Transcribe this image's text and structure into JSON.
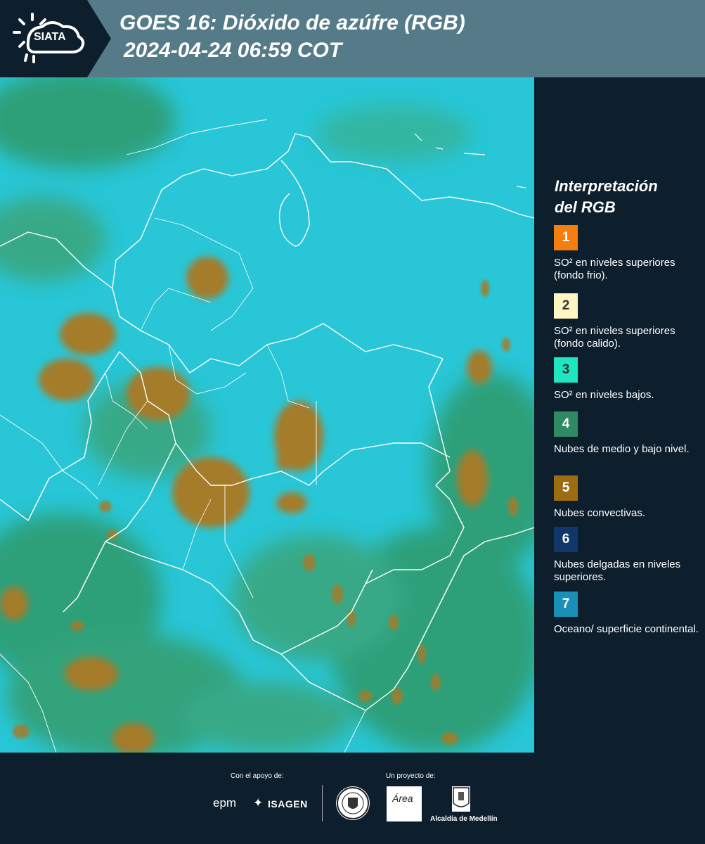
{
  "header": {
    "title_line1": "GOES 16: Dióxido de azúfre (RGB)",
    "title_line2": "2024-04-24 06:59 COT",
    "logo_text": "SIATA",
    "header_color": "#557b89",
    "dark_color": "#0d1e2c"
  },
  "map": {
    "ocean_color": "#28c6d6",
    "cloud_low_color": "#2f9a6a",
    "cloud_convective_color": "#a47c2a",
    "border_color": "#ffffff"
  },
  "legend": {
    "title_line1": "Interpretación",
    "title_line2": "del RGB",
    "items": [
      {
        "number": "1",
        "color": "#f57f0e",
        "number_color": "#ffffff",
        "text": "SO² en niveles superiores (fondo frio)."
      },
      {
        "number": "2",
        "color": "#fff6c2",
        "number_color": "#333333",
        "text": "SO² en niveles superiores (fondo calido)."
      },
      {
        "number": "3",
        "color": "#1de6c0",
        "number_color": "#333333",
        "text": "SO² en niveles bajos."
      },
      {
        "number": "4",
        "color": "#2e8a63",
        "number_color": "#ffffff",
        "text": "Nubes de medio y bajo nivel."
      },
      {
        "number": "5",
        "color": "#9c6c12",
        "number_color": "#ffffff",
        "text": "Nubes convectivas."
      },
      {
        "number": "6",
        "color": "#11366a",
        "number_color": "#ffffff",
        "text": "Nubes delgadas en niveles superiores."
      },
      {
        "number": "7",
        "color": "#1a8fb8",
        "number_color": "#ffffff",
        "text": "Oceano/ superficie continental."
      }
    ]
  },
  "footer": {
    "support_label": "Con el apoyo de:",
    "project_label": "Un proyecto de:",
    "sponsor1": "epm",
    "sponsor2": "ISAGEN",
    "area_logo_text": "Área",
    "alcaldia_label": "Alcaldía de Medellín"
  }
}
